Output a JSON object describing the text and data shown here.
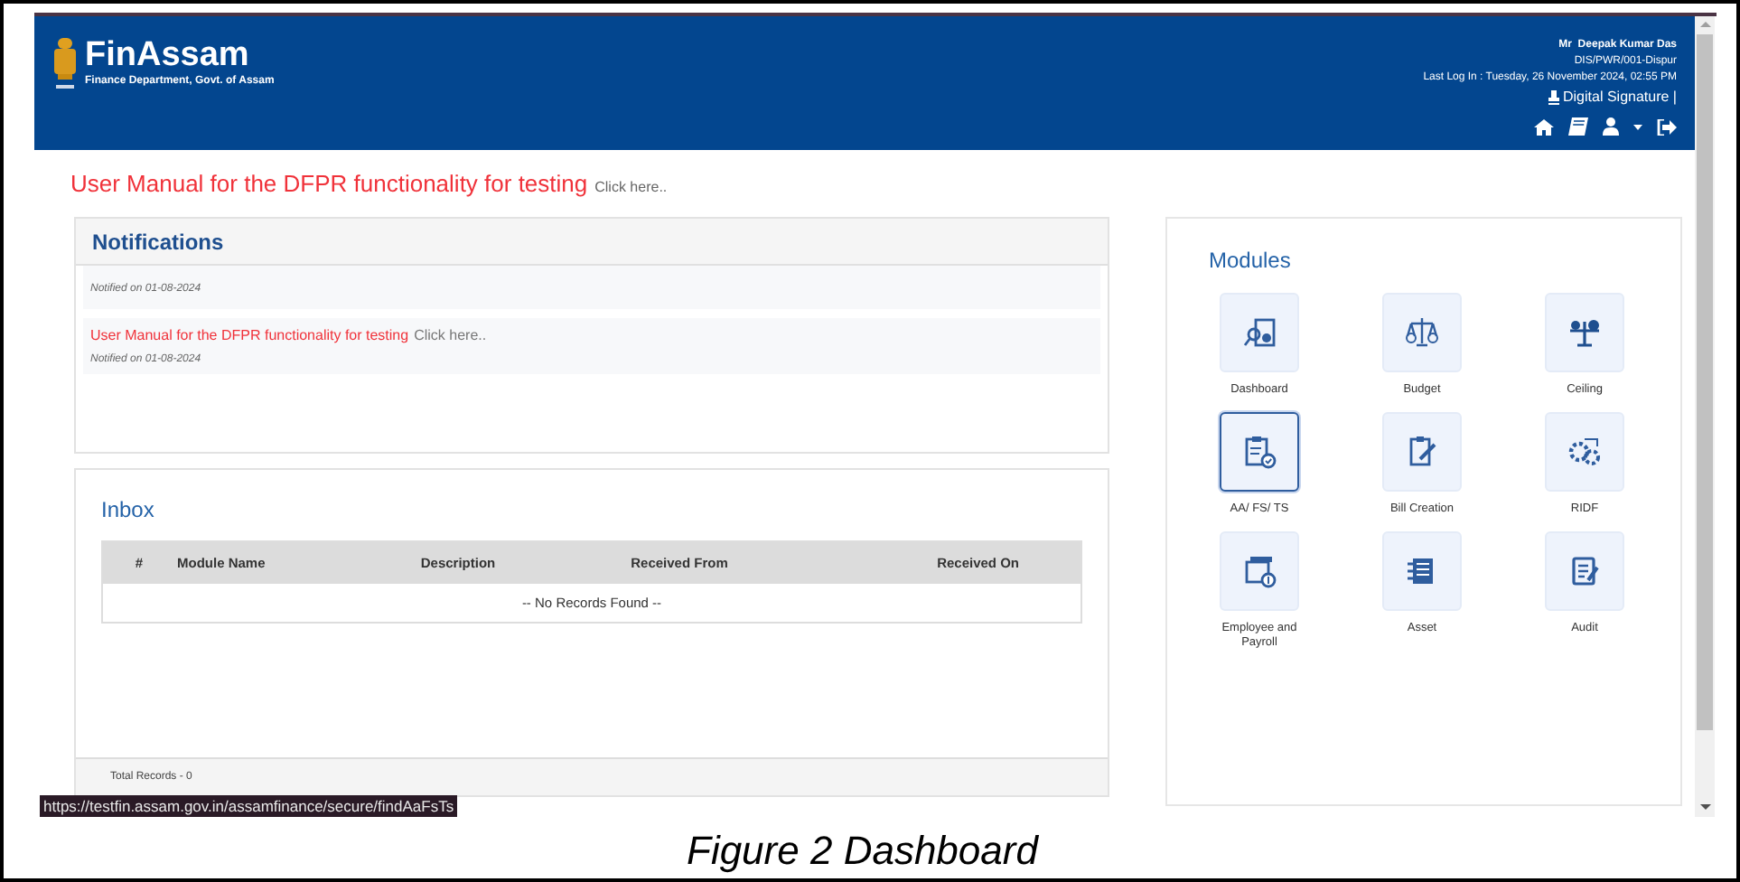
{
  "header": {
    "logo_title": "FinAssam",
    "logo_subtitle": "Finance Department, Govt. of Assam",
    "user_name": "Mr  Deepak Kumar Das",
    "user_office": "DIS/PWR/001-Dispur",
    "last_login": "Last Log In : Tuesday, 26 November 2024, 02:55 PM",
    "digital_signature": "Digital Signature |"
  },
  "banner": {
    "text": "User Manual for the DFPR functionality for testing",
    "link": "Click here.."
  },
  "notifications": {
    "title": "Notifications",
    "items": [
      {
        "date": "Notified on 01-08-2024"
      },
      {
        "text": "User Manual for the DFPR functionality for testing",
        "link": "Click here..",
        "date": "Notified on 01-08-2024"
      }
    ]
  },
  "inbox": {
    "title": "Inbox",
    "columns": [
      "#",
      "Module Name",
      "Description",
      "Received From",
      "Received On"
    ],
    "empty_message": "-- No Records Found --",
    "footer": "Total Records - 0"
  },
  "modules": {
    "title": "Modules",
    "items": [
      {
        "label": "Dashboard",
        "kind": "dashboard",
        "selected": false
      },
      {
        "label": "Budget",
        "kind": "budget",
        "selected": false
      },
      {
        "label": "Ceiling",
        "kind": "ceiling",
        "selected": false
      },
      {
        "label": "AA/ FS/ TS",
        "kind": "clipboard-check",
        "selected": true
      },
      {
        "label": "Bill Creation",
        "kind": "clipboard-pen",
        "selected": false
      },
      {
        "label": "RIDF",
        "kind": "gears",
        "selected": false
      },
      {
        "label": "Employee and Payroll",
        "kind": "payroll",
        "selected": false
      },
      {
        "label": "Asset",
        "kind": "asset",
        "selected": false
      },
      {
        "label": "Audit",
        "kind": "audit",
        "selected": false
      }
    ]
  },
  "status_url": "https://testfin.assam.gov.in/assamfinance/secure/findAaFsTs",
  "caption": "Figure 2 Dashboard"
}
